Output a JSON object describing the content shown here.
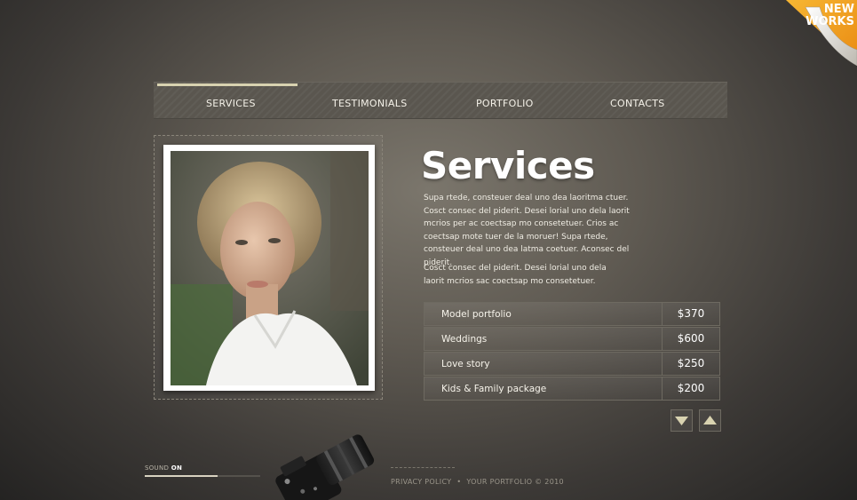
{
  "nav": {
    "items": [
      {
        "label": "SERVICES",
        "active": true
      },
      {
        "label": "TESTIMONIALS"
      },
      {
        "label": "PORTFOLIO"
      },
      {
        "label": "CONTACTS"
      }
    ]
  },
  "corner_badge": {
    "line1": "NEW",
    "line2": "WORKS",
    "color": "#f2a623"
  },
  "main": {
    "title": "Services",
    "paragraph1": "Supa rtede, consteuer deal uno dea laoritma ctuer. Cosct consec del piderit. Desei lorial uno dela laorit mcrios per ac coectsap mo consetetuer.  Crios ac coectsap mote tuer de la moruer! Supa rtede, consteuer deal uno dea latma coetuer. Aconsec del piderit.",
    "paragraph2": "Cosct consec del piderit. Desei lorial uno dela laorit mcrios sac coectsap mo consetetuer.",
    "prices": [
      {
        "name": "Model portfolio",
        "price": "$370"
      },
      {
        "name": "Weddings",
        "price": "$600"
      },
      {
        "name": "Love story",
        "price": "$250"
      },
      {
        "name": "Kids & Family package",
        "price": "$200"
      }
    ],
    "photo_icon": "portrait-photo"
  },
  "sound": {
    "label": "SOUND",
    "state": "ON",
    "level": 0.63
  },
  "footer": {
    "privacy": "PRIVACY POLICY",
    "copyright": "YOUR PORTFOLIO © 2010"
  },
  "colors": {
    "accent": "#d8d2b0",
    "background": "#5f5a52"
  }
}
